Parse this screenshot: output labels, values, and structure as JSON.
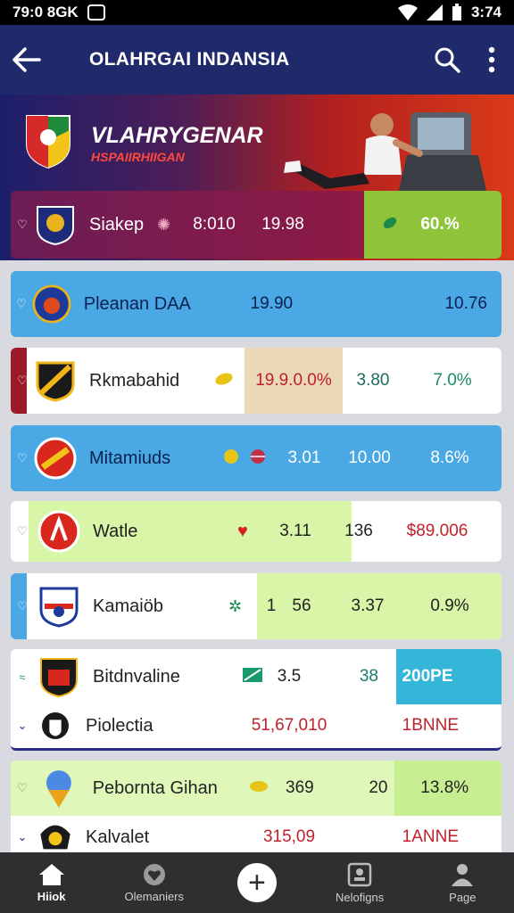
{
  "status": {
    "time": "79:0 8GK",
    "clock": "3:74"
  },
  "app_bar": {
    "title": "OLAHRGAI INDANSIA"
  },
  "banner": {
    "title": "VLAHRYGENAR",
    "subtitle": "HSPAIIRHIIGAN"
  },
  "featured": {
    "name": "Siakep",
    "col1": "8:010",
    "col2": "19.98",
    "pct": "60.%"
  },
  "rows": [
    {
      "name": "Pleanan DAA",
      "c1": "19.90",
      "c2": "10.76"
    },
    {
      "name": "Rkmabahid",
      "c1": "19.9.0.0%",
      "c2": "3.80",
      "c3": "7.0%"
    },
    {
      "name": "Mitamiuds",
      "c1": "3.01",
      "c2": "10.00",
      "c3": "8.6%"
    },
    {
      "name": "Watle",
      "c1": "3.11",
      "c2": "136",
      "c3": "$89.006"
    },
    {
      "name": "Kamaiöb",
      "c0": "1",
      "c1": "56",
      "c2": "3.37",
      "c3": "0.9%"
    },
    {
      "name": "Bitdnvaline",
      "c1": "3.5",
      "c2": "38",
      "c3": "200PE"
    },
    {
      "name": "Piolectia",
      "c1": "51,67,010",
      "c3": "1BNNE"
    },
    {
      "name": "Pebornta Gihan",
      "c1": "369",
      "c2": "20",
      "c3": "13.8%"
    },
    {
      "name": "Kalvalet",
      "c1": "315,09",
      "c3": "1ANNE"
    }
  ],
  "nav": {
    "home": "Hiiok",
    "explore": "Olemaniers",
    "notifications": "Nelofigns",
    "page": "Page"
  },
  "colors": {
    "app_bar": "#1f2a6b",
    "blue_row": "#4aa8e4",
    "lime_row": "#d8f5a8",
    "nav": "#2f2f32"
  }
}
